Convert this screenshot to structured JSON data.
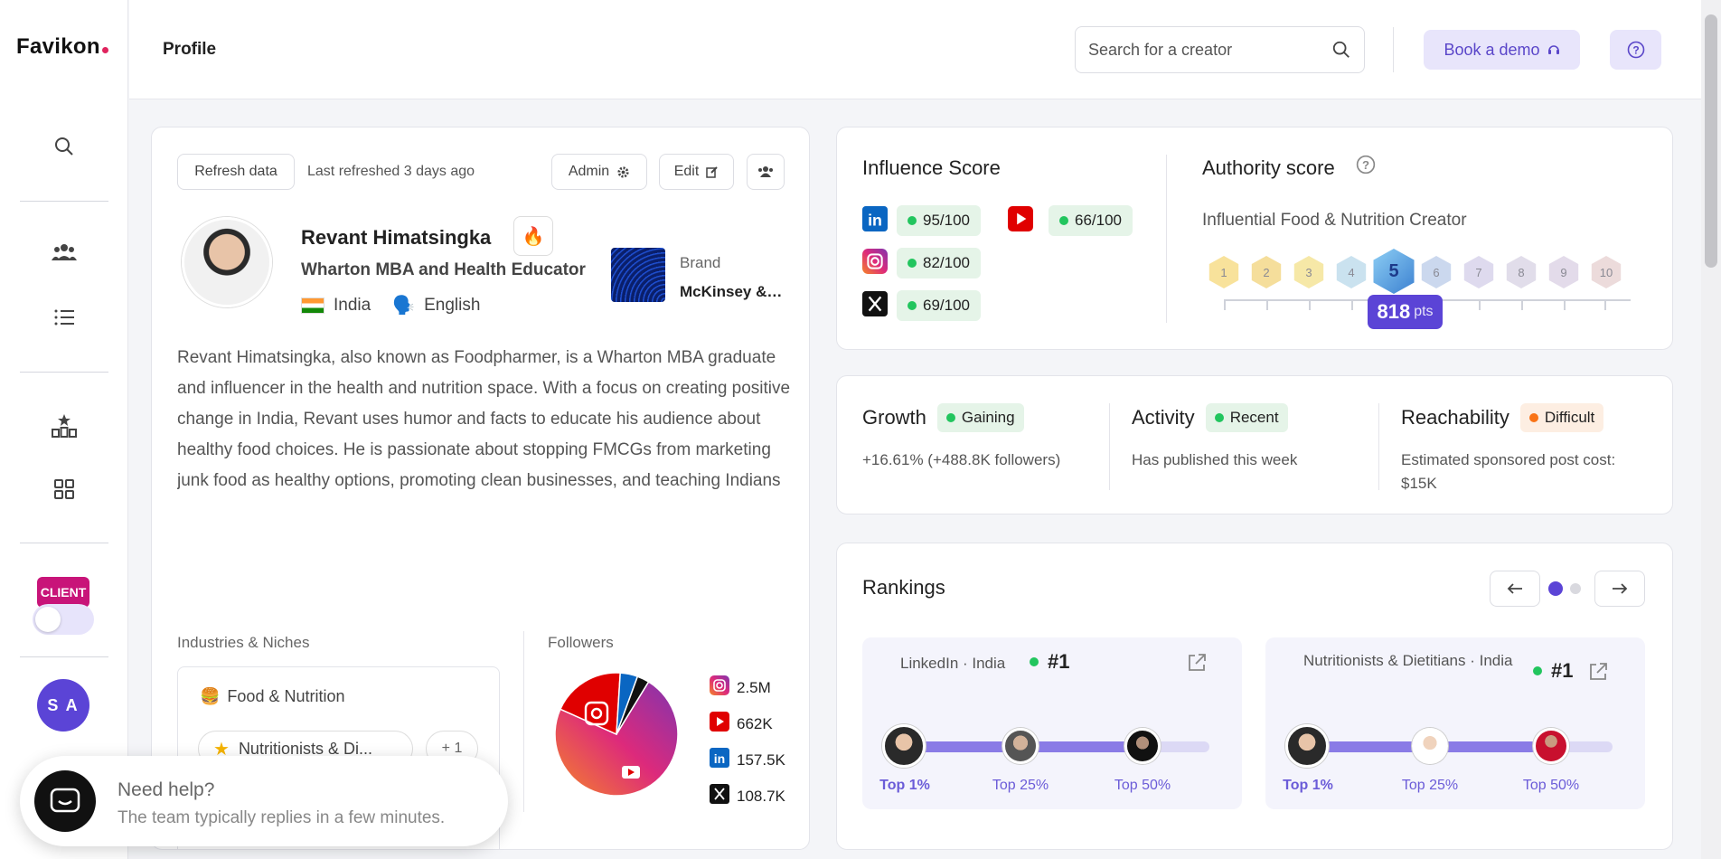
{
  "brand": {
    "name": "Favikon"
  },
  "sidebar": {
    "client_badge": "CLIENT",
    "user_initials": "S A"
  },
  "topbar": {
    "title": "Profile",
    "search_placeholder": "Search for a creator",
    "book_demo": "Book a demo"
  },
  "profile": {
    "refresh_label": "Refresh data",
    "last_refreshed": "Last refreshed 3 days ago",
    "admin_label": "Admin",
    "edit_label": "Edit",
    "name": "Revant Himatsingka",
    "tagline": "Wharton MBA and Health Educator",
    "country": "India",
    "language": "English",
    "brand_label": "Brand",
    "brand_name": "McKinsey & ...",
    "bio": "Revant Himatsingka, also known as Foodpharmer, is a Wharton MBA graduate and influencer in the health and nutrition space. With a focus on creating positive change in India, Revant uses humor and facts to educate his audience about healthy food choices. He is passionate about stopping FMCGs from marketing junk food as healthy options, promoting clean businesses, and teaching Indians how to read food labels. As an author,...",
    "industries_label": "Industries & Niches",
    "industry": "Food & Nutrition",
    "niche": "Nutritionists & Di...",
    "more_count": "+ 1",
    "followers_label": "Followers"
  },
  "followers": {
    "type": "pie",
    "slices": [
      {
        "platform": "Instagram",
        "label": "2.5M",
        "value": 2500000,
        "color": "#c13584"
      },
      {
        "platform": "YouTube",
        "label": "662K",
        "value": 662000,
        "color": "#e00000"
      },
      {
        "platform": "LinkedIn",
        "label": "157.5K",
        "value": 157500,
        "color": "#0a66c2"
      },
      {
        "platform": "X",
        "label": "108.7K",
        "value": 108700,
        "color": "#111111"
      }
    ]
  },
  "help": {
    "title": "Need help?",
    "subtitle": "The team typically replies in a few minutes."
  },
  "influence": {
    "title": "Influence Score",
    "scores": [
      {
        "platform": "linkedin",
        "value": "95/100"
      },
      {
        "platform": "youtube",
        "value": "66/100"
      },
      {
        "platform": "instagram",
        "value": "82/100"
      },
      {
        "platform": "x",
        "value": "69/100"
      }
    ]
  },
  "authority": {
    "title": "Authority score",
    "category": "Influential Food & Nutrition Creator",
    "current_level": 5,
    "levels": [
      "1",
      "2",
      "3",
      "4",
      "5",
      "6",
      "7",
      "8",
      "9",
      "10"
    ],
    "points": "818",
    "points_unit": "pts"
  },
  "metrics": {
    "growth": {
      "title": "Growth",
      "status": "Gaining",
      "detail": "+16.61% (+488.8K followers)"
    },
    "activity": {
      "title": "Activity",
      "status": "Recent",
      "detail": "Has published this week"
    },
    "reachability": {
      "title": "Reachability",
      "status": "Difficult",
      "detail": "Estimated sponsored post cost: $15K"
    }
  },
  "rankings": {
    "title": "Rankings",
    "boxes": [
      {
        "title": "LinkedIn · India",
        "rank": "#1",
        "labels": [
          "Top 1%",
          "Top 25%",
          "Top 50%"
        ]
      },
      {
        "title": "Nutritionists & Dietitians · India",
        "rank": "#1",
        "labels": [
          "Top 1%",
          "Top 25%",
          "Top 50%"
        ]
      }
    ]
  },
  "colors": {
    "accent": "#5b44d6",
    "positive": "#22c55e",
    "warning": "#f97316"
  }
}
